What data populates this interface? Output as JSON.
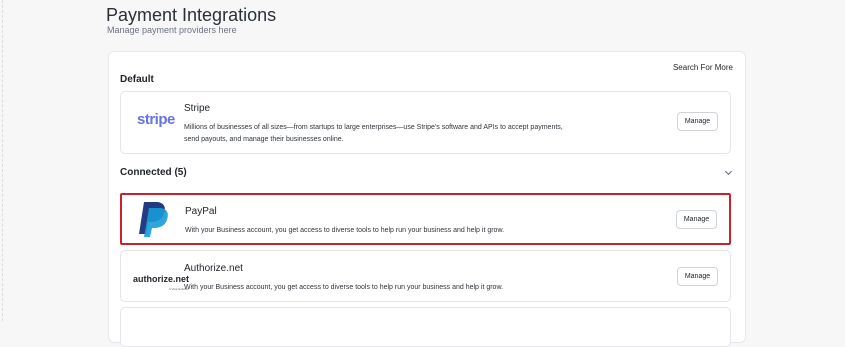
{
  "page": {
    "title": "Payment Integrations",
    "subtitle": "Manage payment providers here"
  },
  "panel": {
    "search_more": "Search For More",
    "default_label": "Default",
    "connected_label": "Connected (5)"
  },
  "providers": [
    {
      "name": "Stripe",
      "logo_text": "stripe",
      "description": "Millions of businesses of all sizes—from startups to large enterprises—use Stripe's software and APIs to accept payments, send payouts, and manage their businesses online.",
      "button": "Manage"
    },
    {
      "name": "PayPal",
      "description": "With your Business account, you get access to diverse tools to help run your business and help it grow.",
      "button": "Manage"
    },
    {
      "name": "Authorize.net",
      "logo_text": "authorize.net",
      "logo_subtext": "A Visa Solution",
      "description": "With your Business account, you get access to diverse tools to help run your business and help it grow.",
      "button": "Manage"
    }
  ],
  "colors": {
    "highlight": "#c8232c",
    "stripe": "#6772e5",
    "paypal_dark": "#253b80",
    "paypal_light": "#179bd7"
  }
}
